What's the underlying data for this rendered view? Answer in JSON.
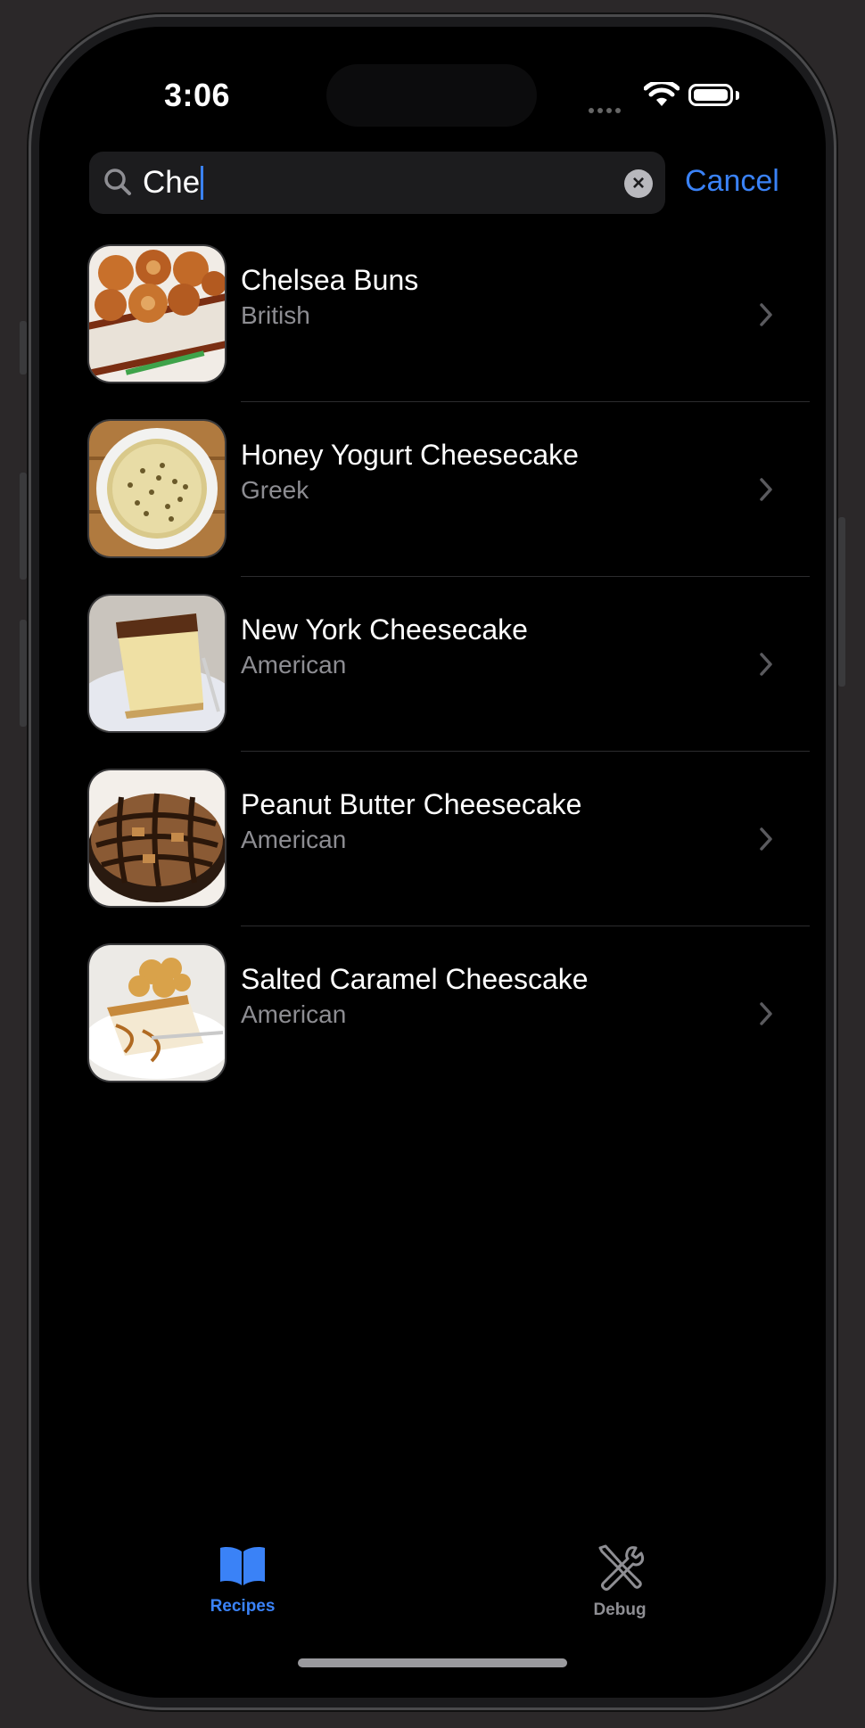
{
  "status": {
    "time": "3:06"
  },
  "search": {
    "value": "Che",
    "cancel_label": "Cancel"
  },
  "results": [
    {
      "title": "Chelsea Buns",
      "cuisine": "British"
    },
    {
      "title": "Honey Yogurt Cheesecake",
      "cuisine": "Greek"
    },
    {
      "title": "New York Cheesecake",
      "cuisine": "American"
    },
    {
      "title": "Peanut Butter Cheesecake",
      "cuisine": "American"
    },
    {
      "title": "Salted Caramel Cheescake",
      "cuisine": "American"
    }
  ],
  "tabs": [
    {
      "label": "Recipes",
      "icon": "book-icon",
      "selected": true
    },
    {
      "label": "Debug",
      "icon": "wrench-screwdriver-icon",
      "selected": false
    }
  ],
  "colors": {
    "accent": "#3a82f7",
    "secondary_text": "#8d8d92",
    "inactive_tab": "#8e8e93"
  }
}
